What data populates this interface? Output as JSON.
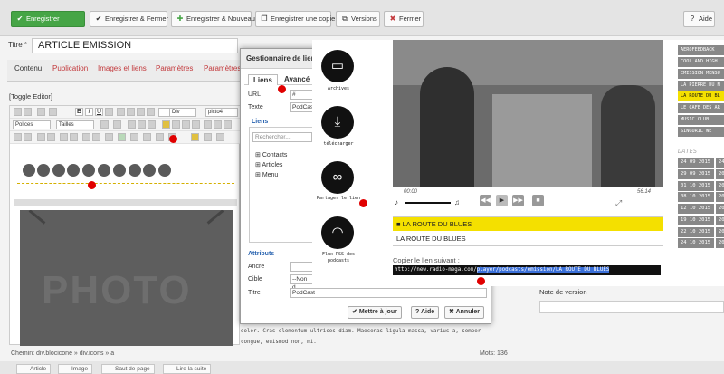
{
  "toolbar": {
    "save": "Enregistrer",
    "save_close": "Enregistrer & Fermer",
    "save_new": "Enregistrer & Nouveau",
    "save_copy": "Enregistrer une copie",
    "versions": "Versions",
    "close": "Fermer",
    "help": "Aide"
  },
  "title": {
    "label": "Titre *",
    "value": "ARTICLE EMISSION"
  },
  "tabs": [
    "Contenu",
    "Publication",
    "Images et liens",
    "Paramètres",
    "Paramètres"
  ],
  "editor": {
    "toggle": "[Toggle Editor]",
    "fonts": "Polices",
    "sizes": "Tailles",
    "div": "Div",
    "picto": "picto4",
    "photo_word": "PHOTO"
  },
  "dialog": {
    "title": "Gestionnaire de lien",
    "tab_links": "Liens",
    "tab_advanced": "Avancé",
    "url_label": "URL",
    "url_value": "#",
    "text_label": "Texte",
    "text_value": "PodCast",
    "links_heading": "Liens",
    "search_placeholder": "Rechercher...",
    "tree": [
      "Contacts",
      "Articles",
      "Menu"
    ],
    "attributes_heading": "Attributs",
    "anchor_label": "Ancre",
    "target_label": "Cible",
    "target_value": "--Non d",
    "title_label": "Titre",
    "title_value": "PodCast",
    "update": "Mettre à jour",
    "help": "Aide",
    "cancel": "Annuler"
  },
  "overlay": {
    "archives": "Archives",
    "download": "télécharger",
    "share": "Partager le lien",
    "rss": "Flux RSS des podcasts",
    "time_start": "00:00",
    "time_end": "56.14",
    "track_selected": "LA ROUTE DU BLUES",
    "track_plain": "LA ROUTE DU BLUES",
    "copy_label": "Copier le lien suivant :",
    "link_plain": "http://new.radio-mega.com/",
    "link_selected": "player/podcasts/emission/LA ROUTE DU BLUES"
  },
  "right_list": [
    "AEROFEEDBACK",
    "COOL AND HIGH",
    "EMISSION MENSU",
    "LA PIERRE DU M",
    "LA ROUTE DU BL",
    "LE CAFE DES AR",
    "MUSIC CLUB",
    "SINGURIL  WE"
  ],
  "dates_heading": "DATES",
  "dates": [
    "24 09 2015",
    "29 09 2015",
    "01 10 2015",
    "08 10 2015",
    "12 10 2015",
    "19 10 2015",
    "22 10 2015",
    "24 10 2015"
  ],
  "dates_b": [
    "24",
    "20",
    "20",
    "20",
    "20",
    "20",
    "20",
    "20"
  ],
  "version_note": "Note de version",
  "text_lines": [
    "dolor. Cras elementum ultrices diam. Maecenas ligula massa, varius a, semper",
    "congue, euismod non, mi."
  ],
  "path": "Chemin: div.blocicone » div.icons » a",
  "words": "Mots: 136",
  "bottom_buttons": [
    "Article",
    "Image",
    "Saut de page",
    "Lire la suite"
  ],
  "colors": {
    "accent_yellow": "#f4e000",
    "red_marker": "#e00000",
    "save_green": "#46a546",
    "tab_red": "#c2373a"
  }
}
